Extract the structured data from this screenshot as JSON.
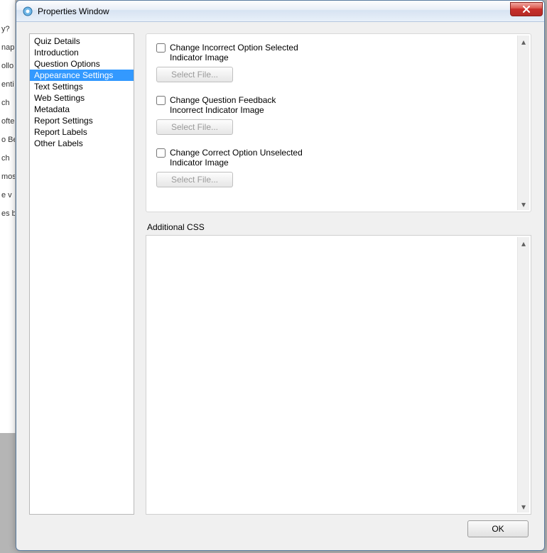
{
  "window": {
    "title": "Properties Window"
  },
  "background_fragments": [
    "y?",
    "nap",
    "ollo",
    "enti",
    "ch",
    "ofte",
    "o Be",
    "ch",
    "mos",
    "e v",
    "es b"
  ],
  "nav": {
    "items": [
      {
        "label": "Quiz Details"
      },
      {
        "label": "Introduction"
      },
      {
        "label": "Question Options"
      },
      {
        "label": "Appearance Settings",
        "selected": true
      },
      {
        "label": "Text Settings"
      },
      {
        "label": "Web Settings"
      },
      {
        "label": "Metadata"
      },
      {
        "label": "Report Settings"
      },
      {
        "label": "Report Labels"
      },
      {
        "label": "Other Labels"
      }
    ]
  },
  "options": [
    {
      "label_line1": "Change Incorrect Option Selected",
      "label_line2": "Indicator Image",
      "button": "Select File..."
    },
    {
      "label_line1": "Change Question Feedback",
      "label_line2": "Incorrect Indicator Image",
      "button": "Select File..."
    },
    {
      "label_line1": "Change Correct Option Unselected",
      "label_line2": "Indicator Image",
      "button": "Select File..."
    }
  ],
  "css_section_label": "Additional CSS",
  "footer": {
    "ok": "OK"
  }
}
